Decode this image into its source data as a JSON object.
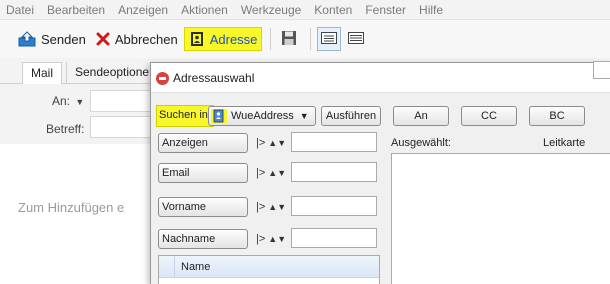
{
  "menu": [
    "Datei",
    "Bearbeiten",
    "Anzeigen",
    "Aktionen",
    "Werkzeuge",
    "Konten",
    "Fenster",
    "Hilfe"
  ],
  "toolbar": {
    "send_label": "Senden",
    "cancel_label": "Abbrechen",
    "address_label": "Adresse",
    "highlight_color": "#f7f72a"
  },
  "tabs": {
    "mail": "Mail",
    "send_options": "Sendeoptione"
  },
  "fields": {
    "to_label": "An:",
    "subject_label": "Betreff:"
  },
  "body_hint": "Zum Hinzufügen e",
  "dialog": {
    "title": "Adressauswahl",
    "search_in_label": "Suchen in:",
    "address_book": "WueAddress",
    "run_button": "Ausführen",
    "to_button": "An",
    "cc_button": "CC",
    "bc_button": "BC",
    "selected_label": "Ausgewählt:",
    "index_card_label": "Leitkarte",
    "filters": [
      {
        "field": "Anzeigen",
        "operator": "|>"
      },
      {
        "field": "Email",
        "operator": "|>"
      },
      {
        "field": "Vorname",
        "operator": "|>"
      },
      {
        "field": "Nachname",
        "operator": "|>"
      }
    ],
    "list_header": "Name"
  }
}
